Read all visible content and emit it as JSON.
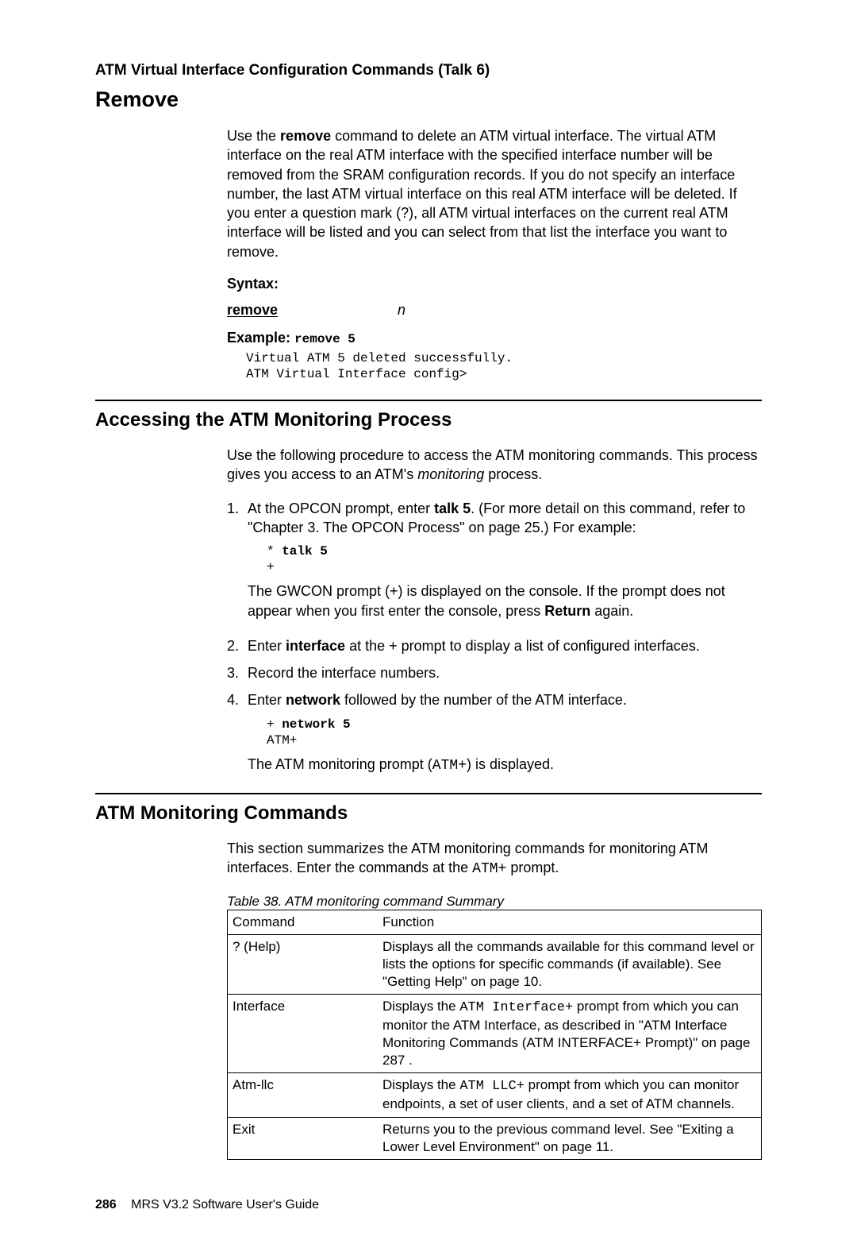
{
  "header": {
    "section_title": "ATM Virtual Interface Configuration Commands (Talk 6)"
  },
  "remove": {
    "heading": "Remove",
    "para_pre": "Use the ",
    "para_cmd": "remove",
    "para_post": " command to delete an ATM virtual interface. The virtual ATM interface on the real ATM interface with the specified interface number will be removed from the SRAM configuration records. If you do not specify an interface number, the last ATM virtual interface on this real ATM interface will be deleted. If you enter a question mark (?), all ATM virtual interfaces on the current real ATM interface will be listed and you can select from that list the interface you want to remove.",
    "syntax_label": "Syntax:",
    "syntax_cmd": "remove",
    "syntax_arg": "n",
    "example_label": "Example:",
    "example_cmd": "remove 5",
    "example_output": "Virtual ATM 5 deleted successfully.\nATM Virtual Interface config>"
  },
  "access": {
    "heading": "Accessing the ATM Monitoring Process",
    "intro_pre": "Use the following procedure to access the ATM monitoring commands. This process gives you access to an ATM's ",
    "intro_em": "monitoring",
    "intro_post": " process.",
    "step1_pre": "At the OPCON prompt, enter ",
    "step1_cmd": "talk 5",
    "step1_post": ". (For more detail on this command, refer to \"Chapter 3. The OPCON Process\" on page 25.) For example:",
    "step1_mono_prefix": "* ",
    "step1_mono_cmd": "talk 5",
    "step1_mono_line2": "+",
    "step1_after_pre": "The GWCON prompt (+) is displayed on the console. If the prompt does not appear when you first enter the console, press ",
    "step1_after_bold": "Return",
    "step1_after_post": " again.",
    "step2_pre": "Enter ",
    "step2_cmd": "interface",
    "step2_post": " at the + prompt to display a list of configured interfaces.",
    "step3": "Record the interface numbers.",
    "step4_pre": "Enter ",
    "step4_cmd": "network",
    "step4_post": " followed by the number of the ATM interface.",
    "step4_mono_prefix": "+ ",
    "step4_mono_cmd": "network 5",
    "step4_mono_line2": "ATM+",
    "step4_after_pre": "The ATM monitoring prompt (",
    "step4_after_mono": "ATM+",
    "step4_after_post": ") is displayed."
  },
  "moncmds": {
    "heading": "ATM Monitoring Commands",
    "intro_pre": "This section summarizes the ATM monitoring commands for monitoring ATM interfaces. Enter the commands at the ",
    "intro_mono": "ATM+",
    "intro_post": " prompt.",
    "caption": "Table 38. ATM monitoring command Summary",
    "head_c1": "Command",
    "head_c2": "Function",
    "rows": [
      {
        "cmd": "? (Help)",
        "func": "Displays all the commands available for this command level or lists the options for specific commands (if available). See \"Getting Help\" on page 10."
      },
      {
        "cmd": "Interface",
        "func_pre": "Displays the ",
        "func_mono": "ATM Interface+",
        "func_post": " prompt from which you can monitor the ATM Interface, as described in \"ATM Interface Monitoring Commands (ATM INTERFACE+ Prompt)\" on page 287 ."
      },
      {
        "cmd": "Atm-llc",
        "func_pre": "Displays the ",
        "func_mono": "ATM LLC+",
        "func_post": " prompt from which you can monitor endpoints, a set of user clients, and a set of ATM channels."
      },
      {
        "cmd": "Exit",
        "func": "Returns you to the previous command level. See \"Exiting a Lower Level Environment\" on page 11."
      }
    ]
  },
  "footer": {
    "page_number": "286",
    "pub": "MRS V3.2 Software User's Guide"
  }
}
